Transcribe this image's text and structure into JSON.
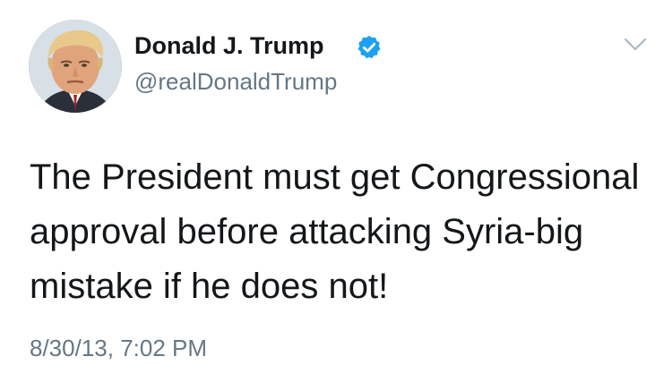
{
  "tweet": {
    "author": {
      "display_name": "Donald J. Trump",
      "handle": "@realDonaldTrump",
      "verified": true,
      "avatar": "profile-photo"
    },
    "text": "The President must get Congressional\napproval before attacking Syria-big\nmistake if he does not!",
    "timestamp": "8/30/13, 7:02 PM",
    "menu_icon": "chevron-down-icon"
  },
  "colors": {
    "text_primary": "#14171a",
    "text_secondary": "#657786",
    "verified_badge": "#1da1f2",
    "caret": "#aab8c2"
  }
}
